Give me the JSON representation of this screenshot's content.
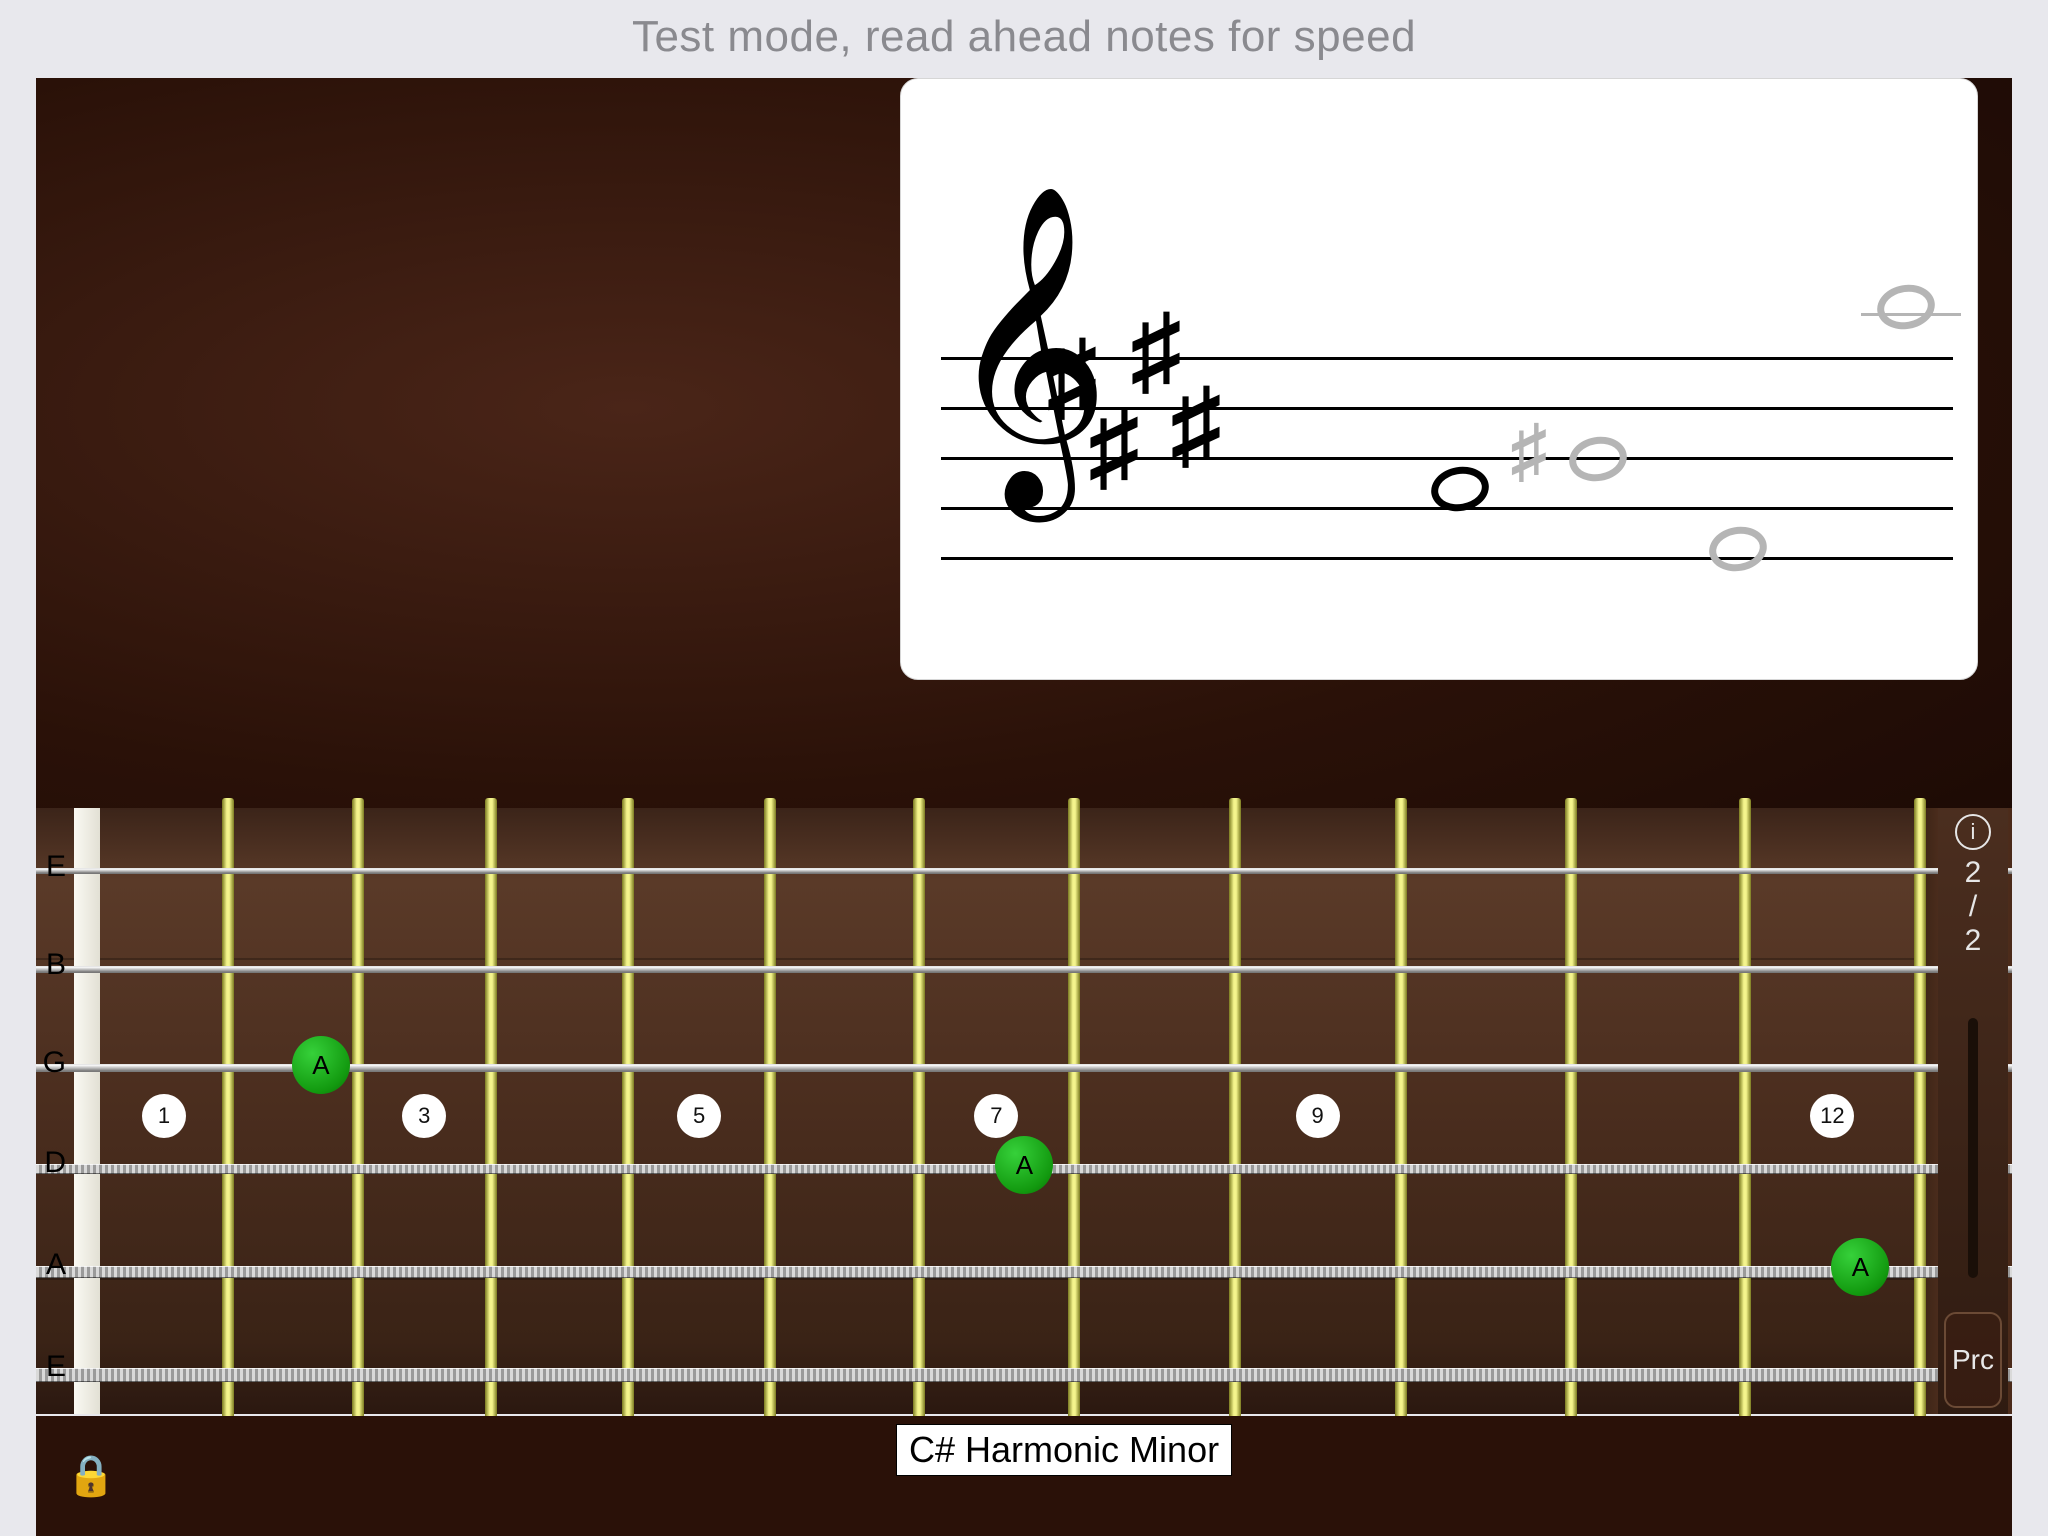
{
  "header": {
    "subtitle": "Test mode, read ahead notes for speed"
  },
  "strings": [
    "E",
    "B",
    "G",
    "D",
    "A",
    "E"
  ],
  "fret_markers": [
    {
      "num": "1",
      "fret": 1
    },
    {
      "num": "3",
      "fret": 3
    },
    {
      "num": "5",
      "fret": 5
    },
    {
      "num": "7",
      "fret": 7
    },
    {
      "num": "9",
      "fret": 9
    },
    {
      "num": "12",
      "fret": 12
    }
  ],
  "note_dots": [
    {
      "label": "A",
      "string": 2,
      "fret": 2
    },
    {
      "label": "A",
      "string": 3,
      "fret": 7
    },
    {
      "label": "A",
      "string": 4,
      "fret": 12
    }
  ],
  "side": {
    "score_top": "2",
    "slash": "/",
    "score_bot": "2",
    "prc": "Prc"
  },
  "scale_label": "C# Harmonic Minor"
}
